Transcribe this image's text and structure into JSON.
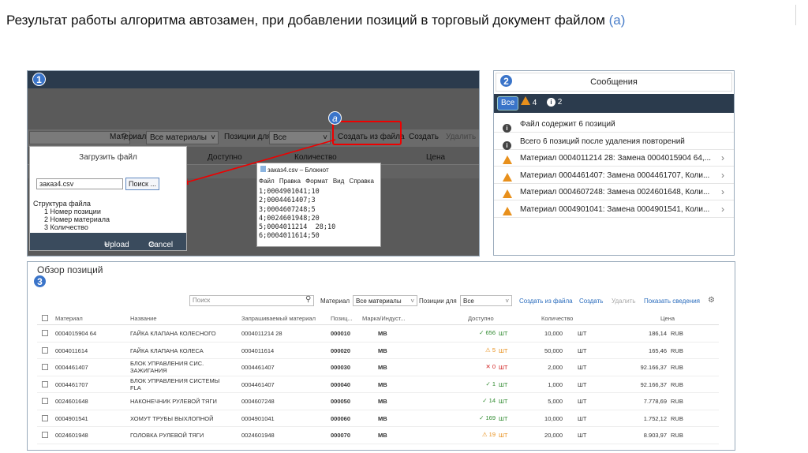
{
  "title": {
    "main": "Результат работы алгоритма автозамен, при добавлении позиций в торговый документ файлом",
    "sub": "(а)"
  },
  "panel1": {
    "badge": "1",
    "a_label": "а",
    "toolbar": {
      "material_label": "Материал",
      "material_value": "Все материалы",
      "positions_label": "Позиции для",
      "positions_value": "Все",
      "create_from_file": "Создать из файла",
      "create": "Создать",
      "delete": "Удалить"
    },
    "columns": [
      "Доступно",
      "Количество",
      "Цена"
    ],
    "upload": {
      "title": "Загрузить файл",
      "file_value": "заказ4.csv",
      "browse": "Поиск ...",
      "structure_title": "Структура файла",
      "structure_items": [
        "1 Номер позиции",
        "2 Номер материала",
        "3 Количество"
      ],
      "upload_btn": "Upload",
      "cancel_btn": "Cancel"
    },
    "notepad": {
      "title": "заказ4.csv – Блокнот",
      "menu": [
        "Файл",
        "Правка",
        "Формат",
        "Вид",
        "Справка"
      ],
      "lines": "1;0004901041;10\n2;0004461407;3\n3;0004607248;5\n4;0024601948;20\n5;0004011214  28;10\n6;0004011614;50"
    }
  },
  "panel2": {
    "badge": "2",
    "header": "Сообщения",
    "tabs": {
      "all": "Все",
      "warn_count": "4",
      "info_count": "2"
    },
    "messages": [
      {
        "type": "info",
        "text": "Файл содержит 6 позиций"
      },
      {
        "type": "info",
        "text": "Всего 6 позиций после удаления повторений"
      },
      {
        "type": "warn",
        "text": "Материал 0004011214 28: Замена 0004015904 64,..."
      },
      {
        "type": "warn",
        "text": "Материал 0004461407: Замена 0004461707, Коли..."
      },
      {
        "type": "warn",
        "text": "Материал 0004607248: Замена 0024601648, Коли..."
      },
      {
        "type": "warn",
        "text": "Материал 0004901041: Замена 0004901541, Коли..."
      }
    ]
  },
  "panel3": {
    "badge": "3",
    "title": "Обзор позиций",
    "toolbar": {
      "search_placeholder": "Поиск",
      "material_label": "Материал",
      "material_value": "Все материалы",
      "positions_label": "Позиции для",
      "positions_value": "Все",
      "create_from_file": "Создать из файла",
      "create": "Создать",
      "delete": "Удалить",
      "show_info": "Показать сведения"
    },
    "headers": [
      "Материал",
      "Название",
      "Запрашиваемый материал",
      "Позиц...",
      "Марка/Индуст...",
      "Доступно",
      "Количество",
      "Цена"
    ],
    "rows": [
      {
        "mat": "0004015904 64",
        "name": "ГАЙКА КЛАПАНА КОЛЕСНОГО",
        "req": "0004011214 28",
        "pos": "000010",
        "brand": "MB",
        "status": "ok",
        "avail": "656",
        "unit": "ШТ",
        "qty": "10,000",
        "qunit": "ШТ",
        "price": "186,14",
        "cur": "RUB"
      },
      {
        "mat": "0004011614",
        "name": "ГАЙКА КЛАПАНА КОЛЕСА",
        "req": "0004011614",
        "pos": "000020",
        "brand": "MB",
        "status": "wn",
        "avail": "5",
        "unit": "ШТ",
        "qty": "50,000",
        "qunit": "ШТ",
        "price": "165,46",
        "cur": "RUB"
      },
      {
        "mat": "0004461407",
        "name": "БЛОК УПРАВЛЕНИЯ СИС. ЗАЖИГАНИЯ",
        "req": "0004461407",
        "pos": "000030",
        "brand": "MB",
        "status": "er",
        "avail": "0",
        "unit": "ШТ",
        "qty": "2,000",
        "qunit": "ШТ",
        "price": "92.166,37",
        "cur": "RUB"
      },
      {
        "mat": "0004461707",
        "name": "БЛОК УПРАВЛЕНИЯ СИСТЕМЫ FLA",
        "req": "0004461407",
        "pos": "000040",
        "brand": "MB",
        "status": "ok",
        "avail": "1",
        "unit": "ШТ",
        "qty": "1,000",
        "qunit": "ШТ",
        "price": "92.166,37",
        "cur": "RUB"
      },
      {
        "mat": "0024601648",
        "name": "НАКОНЕЧНИК РУЛЕВОЙ ТЯГИ",
        "req": "0004607248",
        "pos": "000050",
        "brand": "MB",
        "status": "ok",
        "avail": "14",
        "unit": "ШТ",
        "qty": "5,000",
        "qunit": "ШТ",
        "price": "7.778,69",
        "cur": "RUB"
      },
      {
        "mat": "0004901541",
        "name": "ХОМУТ ТРУБЫ ВЫХЛОПНОЙ",
        "req": "0004901041",
        "pos": "000060",
        "brand": "MB",
        "status": "ok",
        "avail": "169",
        "unit": "ШТ",
        "qty": "10,000",
        "qunit": "ШТ",
        "price": "1.752,12",
        "cur": "RUB"
      },
      {
        "mat": "0024601948",
        "name": "ГОЛОВКА РУЛЕВОЙ ТЯГИ",
        "req": "0024601948",
        "pos": "000070",
        "brand": "MB",
        "status": "wn",
        "avail": "19",
        "unit": "ШТ",
        "qty": "20,000",
        "qunit": "ШТ",
        "price": "8.903,97",
        "cur": "RUB"
      }
    ]
  }
}
